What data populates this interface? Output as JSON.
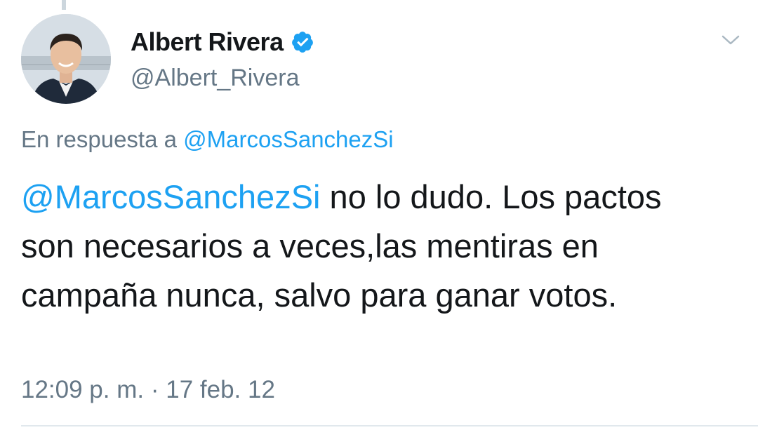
{
  "author": {
    "display_name": "Albert Rivera",
    "handle": "@Albert_Rivera",
    "verified": true,
    "avatar_icon": "profile-photo"
  },
  "reply": {
    "prefix": "En respuesta a",
    "mention": "@MarcosSanchezSi"
  },
  "tweet": {
    "mention": "@MarcosSanchezSi",
    "text": " no lo dudo. Los pactos son necesarios a veces,las mentiras en campaña nunca, salvo para ganar votos."
  },
  "meta": {
    "time": "12:09 p. m.",
    "separator": "·",
    "date": "17 feb. 12"
  },
  "colors": {
    "link": "#1da1f2",
    "secondary_text": "#657786",
    "primary_text": "#14171a",
    "verified_badge": "#1da1f2"
  },
  "icons": {
    "verified": "verified-badge-icon",
    "menu": "chevron-down-icon"
  }
}
